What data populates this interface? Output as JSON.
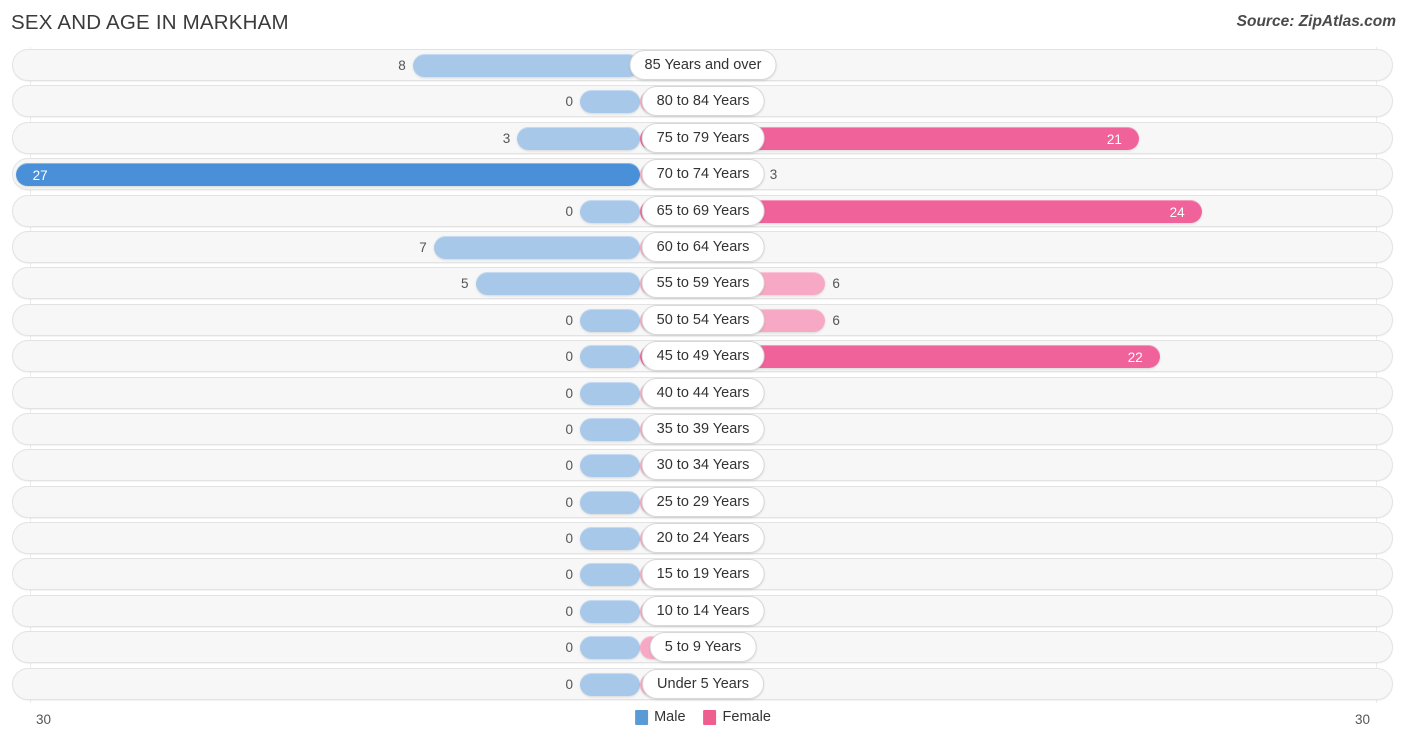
{
  "header": {
    "title": "SEX AND AGE IN MARKHAM",
    "source": "Source: ZipAtlas.com"
  },
  "legend": {
    "male_label": "Male",
    "female_label": "Female",
    "male_color": "#5b9bd5",
    "female_color": "#ee5f8f"
  },
  "axis": {
    "left_label": "30",
    "right_label": "30",
    "max": 30
  },
  "colors": {
    "male_strong": "#4a90d9",
    "male_pale": "#a8c8ea",
    "female_strong": "#f0629a",
    "female_pale": "#f7a8c4",
    "track": "#f7f7f7",
    "track_border": "#e3e3e3"
  },
  "chart_data": {
    "type": "bar",
    "title": "SEX AND AGE IN MARKHAM",
    "subtitle": "",
    "xlabel": "",
    "ylabel": "",
    "orientation": "horizontal",
    "layout": "population-pyramid",
    "xlim": [
      30,
      30
    ],
    "grid": true,
    "legend_position": "bottom-center",
    "categories": [
      "85 Years and over",
      "80 to 84 Years",
      "75 to 79 Years",
      "70 to 74 Years",
      "65 to 69 Years",
      "60 to 64 Years",
      "55 to 59 Years",
      "50 to 54 Years",
      "45 to 49 Years",
      "40 to 44 Years",
      "35 to 39 Years",
      "30 to 34 Years",
      "25 to 29 Years",
      "20 to 24 Years",
      "15 to 19 Years",
      "10 to 14 Years",
      "5 to 9 Years",
      "Under 5 Years"
    ],
    "series": [
      {
        "name": "Male",
        "color": "#4a90d9",
        "values": [
          8,
          0,
          3,
          27,
          0,
          7,
          5,
          0,
          0,
          0,
          0,
          0,
          0,
          0,
          0,
          0,
          0,
          0
        ]
      },
      {
        "name": "Female",
        "color": "#f0629a",
        "values": [
          0,
          0,
          21,
          3,
          24,
          0,
          6,
          6,
          22,
          0,
          0,
          0,
          0,
          0,
          0,
          0,
          0,
          0
        ]
      }
    ]
  },
  "rows": [
    {
      "label": "85 Years and over",
      "male": "8",
      "female": "0"
    },
    {
      "label": "80 to 84 Years",
      "male": "0",
      "female": "0"
    },
    {
      "label": "75 to 79 Years",
      "male": "3",
      "female": "21"
    },
    {
      "label": "70 to 74 Years",
      "male": "27",
      "female": "3"
    },
    {
      "label": "65 to 69 Years",
      "male": "0",
      "female": "24"
    },
    {
      "label": "60 to 64 Years",
      "male": "7",
      "female": "0"
    },
    {
      "label": "55 to 59 Years",
      "male": "5",
      "female": "6"
    },
    {
      "label": "50 to 54 Years",
      "male": "0",
      "female": "6"
    },
    {
      "label": "45 to 49 Years",
      "male": "0",
      "female": "22"
    },
    {
      "label": "40 to 44 Years",
      "male": "0",
      "female": "0"
    },
    {
      "label": "35 to 39 Years",
      "male": "0",
      "female": "0"
    },
    {
      "label": "30 to 34 Years",
      "male": "0",
      "female": "0"
    },
    {
      "label": "25 to 29 Years",
      "male": "0",
      "female": "0"
    },
    {
      "label": "20 to 24 Years",
      "male": "0",
      "female": "0"
    },
    {
      "label": "15 to 19 Years",
      "male": "0",
      "female": "0"
    },
    {
      "label": "10 to 14 Years",
      "male": "0",
      "female": "0"
    },
    {
      "label": "5 to 9 Years",
      "male": "0",
      "female": "0"
    },
    {
      "label": "Under 5 Years",
      "male": "0",
      "female": "0"
    }
  ]
}
